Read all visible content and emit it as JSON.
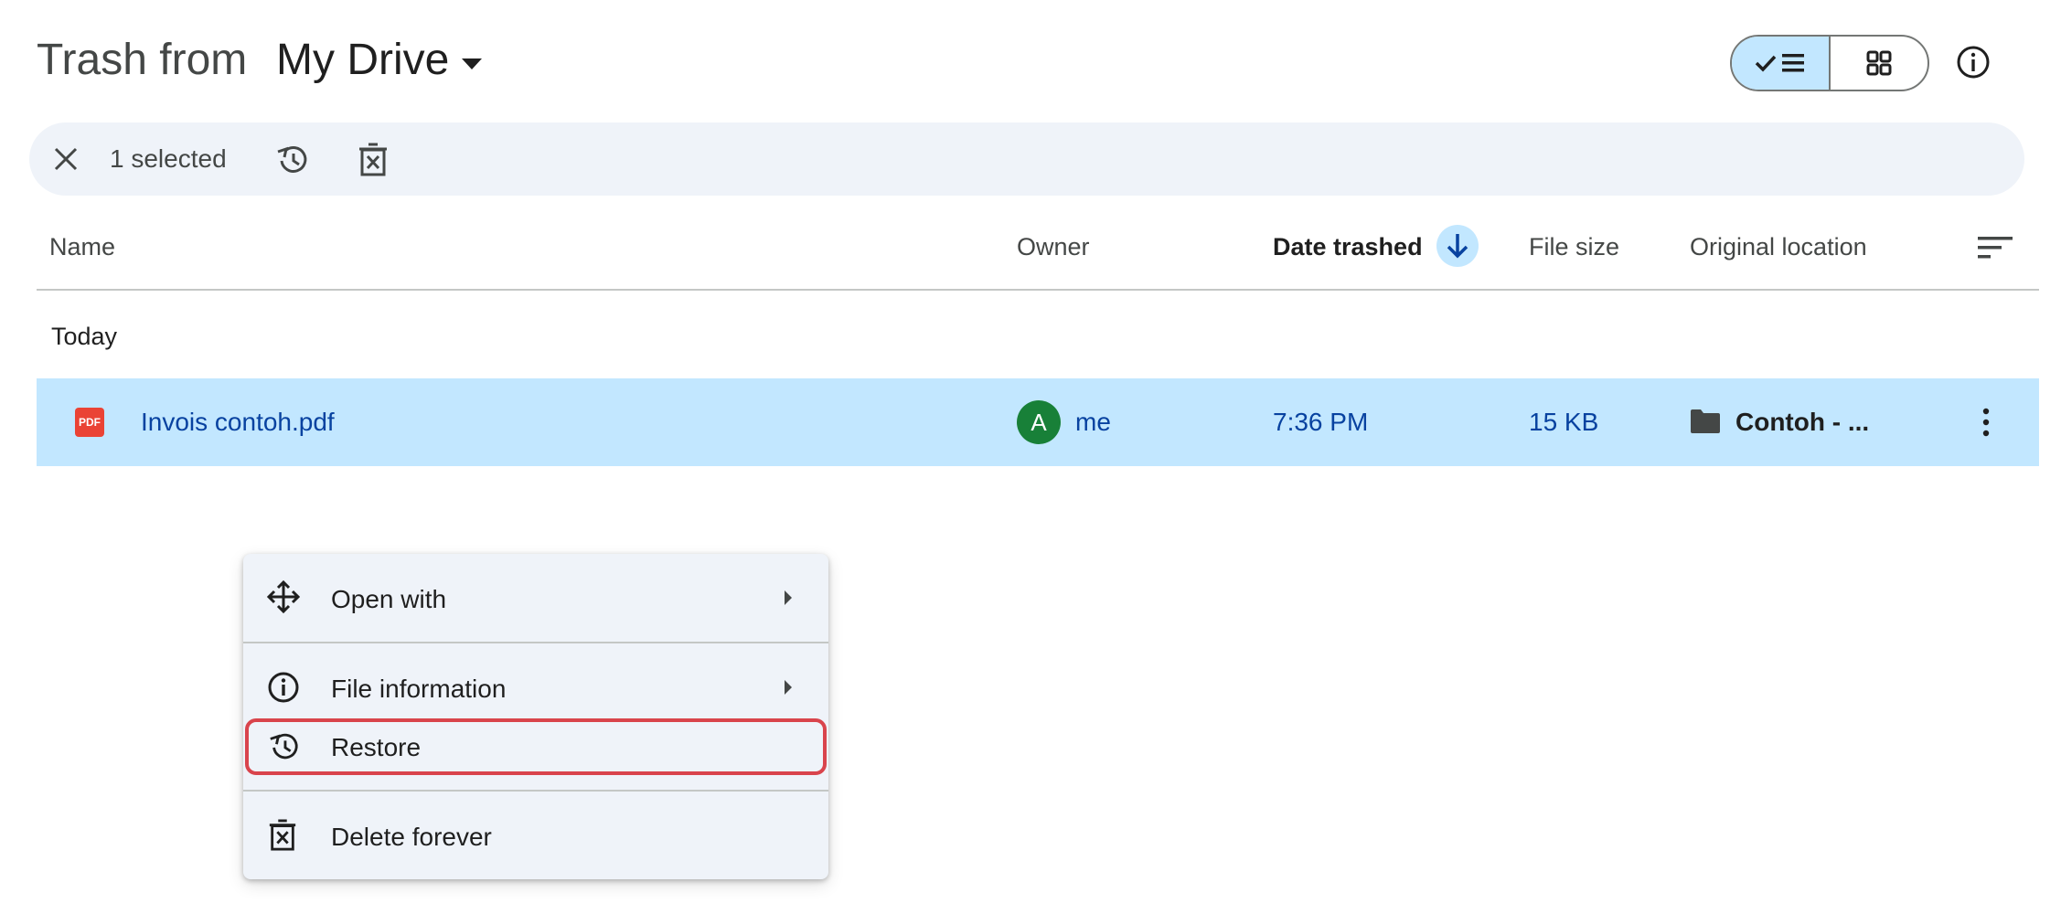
{
  "header": {
    "title_prefix": "Trash from",
    "title_location": "My Drive"
  },
  "view": {
    "mode": "list"
  },
  "selection": {
    "count_label": "1 selected"
  },
  "columns": {
    "name": "Name",
    "owner": "Owner",
    "date": "Date trashed",
    "size": "File size",
    "location": "Original location"
  },
  "groups": [
    {
      "label": "Today",
      "files": [
        {
          "type_badge": "PDF",
          "name": "Invois contoh.pdf",
          "owner_initial": "A",
          "owner": "me",
          "date": "7:36 PM",
          "size": "15 KB",
          "location": "Contoh - ..."
        }
      ]
    }
  ],
  "context_menu": {
    "items": [
      {
        "label": "Open with",
        "icon": "open-with-icon",
        "submenu": true
      },
      {
        "label": "File information",
        "icon": "info-icon",
        "submenu": true
      },
      {
        "label": "Restore",
        "icon": "restore-icon",
        "submenu": false,
        "highlighted": true
      },
      {
        "label": "Delete forever",
        "icon": "delete-forever-icon",
        "submenu": false
      }
    ]
  },
  "colors": {
    "selected_row": "#c2e7ff",
    "selection_bar": "#eff3f9",
    "highlight_border": "#d9444c",
    "avatar": "#188038",
    "pdf_badge": "#ea4335"
  }
}
